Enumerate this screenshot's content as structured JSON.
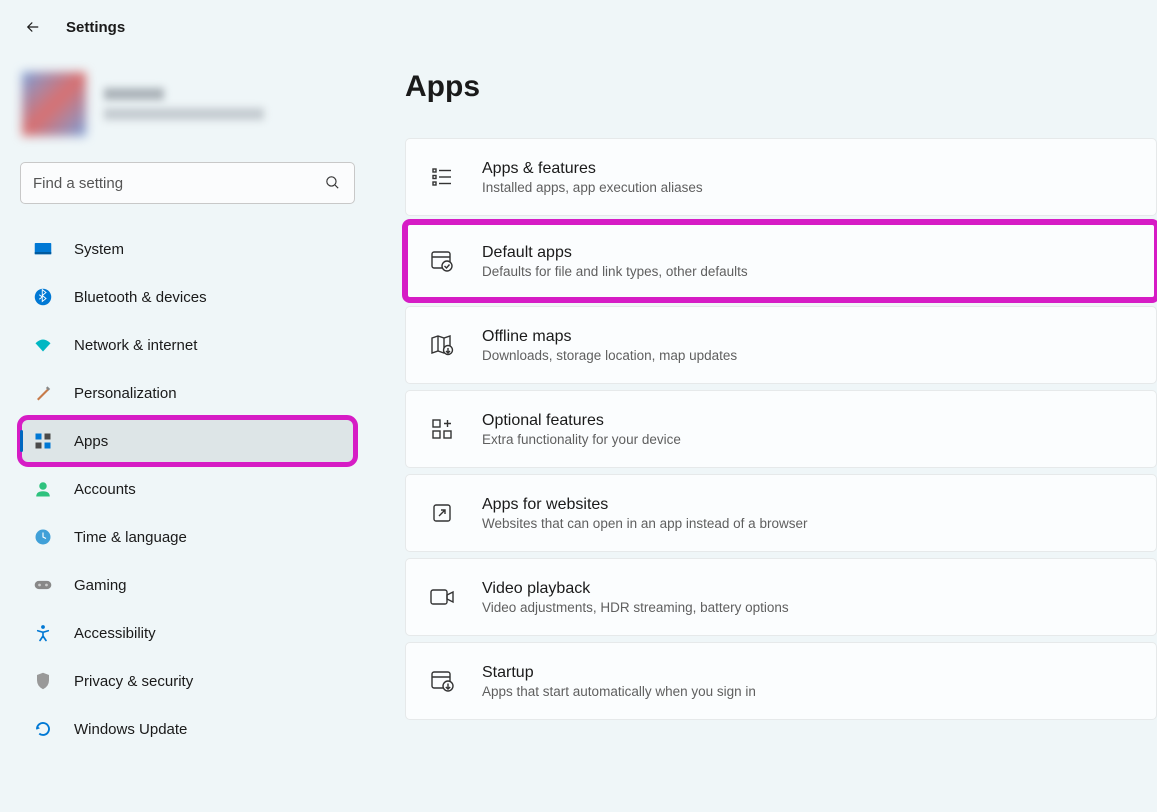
{
  "header": {
    "title": "Settings"
  },
  "search": {
    "placeholder": "Find a setting"
  },
  "nav": {
    "items": [
      {
        "id": "system",
        "label": "System"
      },
      {
        "id": "bluetooth",
        "label": "Bluetooth & devices"
      },
      {
        "id": "network",
        "label": "Network & internet"
      },
      {
        "id": "personalization",
        "label": "Personalization"
      },
      {
        "id": "apps",
        "label": "Apps",
        "active": true,
        "highlighted": true
      },
      {
        "id": "accounts",
        "label": "Accounts"
      },
      {
        "id": "time",
        "label": "Time & language"
      },
      {
        "id": "gaming",
        "label": "Gaming"
      },
      {
        "id": "accessibility",
        "label": "Accessibility"
      },
      {
        "id": "privacy",
        "label": "Privacy & security"
      },
      {
        "id": "update",
        "label": "Windows Update"
      }
    ]
  },
  "page": {
    "title": "Apps",
    "cards": [
      {
        "id": "apps-features",
        "title": "Apps & features",
        "sub": "Installed apps, app execution aliases"
      },
      {
        "id": "default-apps",
        "title": "Default apps",
        "sub": "Defaults for file and link types, other defaults",
        "highlighted": true
      },
      {
        "id": "offline-maps",
        "title": "Offline maps",
        "sub": "Downloads, storage location, map updates"
      },
      {
        "id": "optional-features",
        "title": "Optional features",
        "sub": "Extra functionality for your device"
      },
      {
        "id": "apps-websites",
        "title": "Apps for websites",
        "sub": "Websites that can open in an app instead of a browser"
      },
      {
        "id": "video-playback",
        "title": "Video playback",
        "sub": "Video adjustments, HDR streaming, battery options"
      },
      {
        "id": "startup",
        "title": "Startup",
        "sub": "Apps that start automatically when you sign in"
      }
    ]
  }
}
